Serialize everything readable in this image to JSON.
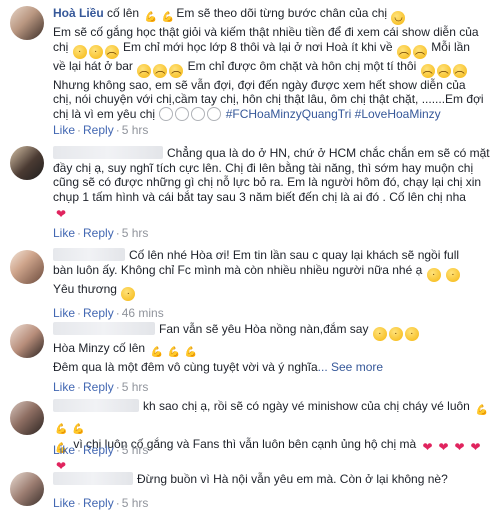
{
  "comments": [
    {
      "name": "Hoà Liều",
      "text_a": "cố lên ",
      "text_b": "Em sẽ theo dõi từng bước chân của chị ",
      "line2": "Em sẽ cố gắng học thật giỏi và kiếm thật nhiều tiền để đi xem cái show diễn của",
      "line3a": "chị ",
      "line3b": " Em chỉ mới học lớp 8 thôi và lại ở nơi Hoà ít khi về ",
      "line3c": "Mỗi lần",
      "line4a": "về lại hát ở bar ",
      "line4b": " Em chỉ được ôm chặt và hôn chị một tí thôi ",
      "line5": "Nhưng không sao, em sẽ vẫn đợi, đợi đến ngày được xem hết show diễn của",
      "line6": "chị, nói chuyện với chị,cầm tay chị, hôn chị thật lâu, ôm chị thật chặt, .......Em đợi",
      "line7a": "chị là vì em yêu chị ",
      "line7b": " #FCHoaMinzyQuangTri #LoveHoaMinzy",
      "like": "Like",
      "reply": "Reply",
      "time": "5 hrs"
    },
    {
      "line1": "Chẳng qua là do ở HN, chứ ở HCM chắc chắn em sẽ có mặt",
      "line2": "đầy chị ạ, suy nghĩ tích cực lên. Chị đi lên bằng tài năng, thì sớm hay muộn chị",
      "line3": "cũng sẽ có được những gì chị nỗ lực bỏ ra. Em là người hôm đó, chạy lại chị xin",
      "line4": "chụp 1 tấm hình và cái bắt tay sau 3 năm biết đến chị là ai đó . Cố lên chị nha",
      "like": "Like",
      "reply": "Reply",
      "time": "5 hrs"
    },
    {
      "line1": "Cố lên nhé Hòa ơi! Em tin lần sau c quay lại khách sẽ ngồi full",
      "line2a": "bàn luôn ấy. Không chỉ Fc mình mà còn nhiều nhiều người nữa nhé ạ ",
      "line3": "Yêu thương ",
      "like": "Like",
      "reply": "Reply",
      "time": "46 mins"
    },
    {
      "line1": "Fan vẫn sẽ yêu Hòa nồng nàn,đắm say ",
      "line2": "Hòa Minzy cố lên ",
      "line3": "Đêm qua là một đêm vô cùng tuyệt vời và ý nghĩa",
      "seemore": "... See more",
      "like": "Like",
      "reply": "Reply",
      "time": "5 hrs"
    },
    {
      "line1": "kh sao chị ạ, rồi sẽ có ngày vé minishow của chị cháy vé luôn ",
      "line2": " vì chị luôn cố gắng và Fans thì vẫn luôn bên cạnh ủng hộ chị mà ",
      "like": "Like",
      "reply": "Reply",
      "time": "5 hrs"
    },
    {
      "line1": "Đừng buồn vì Hà nội vẫn yêu em mà. Còn ở lại không nè?",
      "like": "Like",
      "reply": "Reply",
      "time": "5 hrs"
    }
  ],
  "colors": {
    "name": "#365899",
    "link": "#4267b2",
    "meta": "#90949c",
    "heart": "#f0284a"
  },
  "icons": [
    "muscle-emoji-icon",
    "sad-face-emoji-icon",
    "kiss-face-emoji-icon",
    "laugh-face-emoji-icon",
    "heart-emoji-icon"
  ]
}
